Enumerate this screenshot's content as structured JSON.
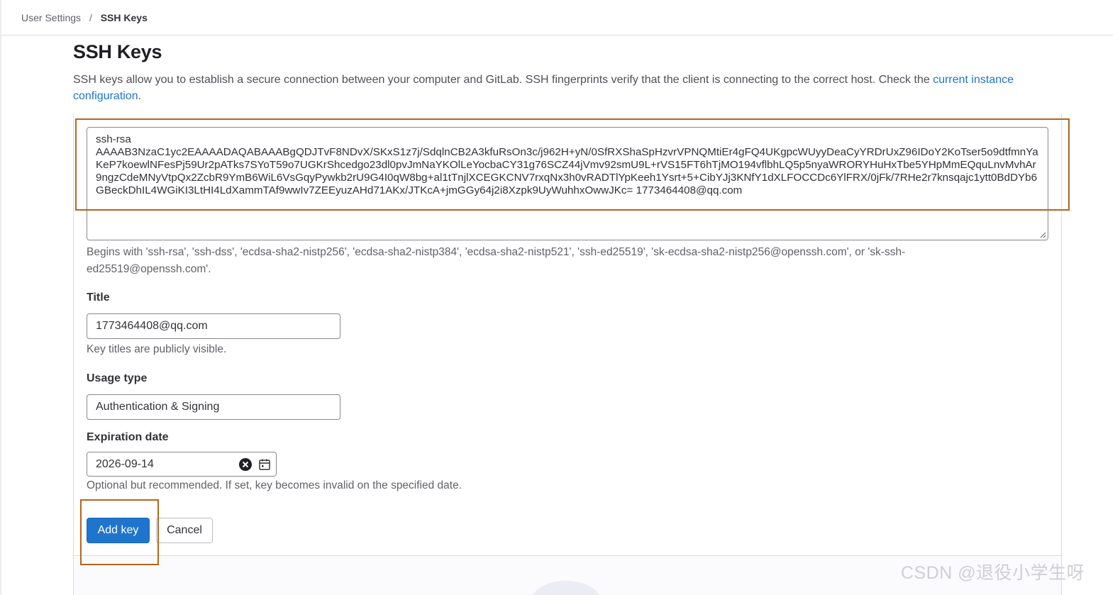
{
  "breadcrumb": {
    "parent": "User Settings",
    "separator": "/",
    "current": "SSH Keys"
  },
  "page": {
    "title": "SSH Keys",
    "description_prefix": "SSH keys allow you to establish a secure connection between your computer and GitLab. SSH fingerprints verify that the client is connecting to the correct host. Check the ",
    "description_link": "current instance configuration",
    "description_suffix": "."
  },
  "key_field": {
    "value": "ssh-rsa\nAAAAB3NzaC1yc2EAAAADAQABAAABgQDJTvF8NDvX/SKxS1z7j/SdqlnCB2A3kfuRsOn3c/j962H+yN/0SfRXShaSpHzvrVPNQMtiEr4gFQ4UKgpcWUyyDeaCyYRDrUxZ96IDoY2KoTser5o9dtfmnYaKeP7koewlNFesPj59Ur2pATks7SYoT59o7UGKrShcedgo23dl0pvJmNaYKOlLeYocbaCY31g76SCZ44jVmv92smU9L+rVS15FT6hTjMO194vflbhLQ5p5nyaWRORYHuHxTbe5YHpMmEQquLnvMvhAr9ngzCdeMNyVtpQx2ZcbR9YmB6WiL6VsGqyPywkb2rU9G4I0qW8bg+al1tTnjlXCEGKCNV7rxqNx3h0vRADTlYpKeeh1Ysrt+5+CibYJj3KNfY1dXLFOCCDc6YlFRX/0jFk/7RHe2r7knsqajc1ytt0BdDYb6GBeckDhIL4WGiKI3LtHI4LdXammTAf9wwIv7ZEEyuzAHd71AKx/JTKcA+jmGGy64j2i8Xzpk9UyWuhhxOwwJKc= 1773464408@qq.com",
    "help": "Begins with 'ssh-rsa', 'ssh-dss', 'ecdsa-sha2-nistp256', 'ecdsa-sha2-nistp384', 'ecdsa-sha2-nistp521', 'ssh-ed25519', 'sk-ecdsa-sha2-nistp256@openssh.com', or 'sk-ssh-ed25519@openssh.com'."
  },
  "title_field": {
    "label": "Title",
    "value": "1773464408@qq.com",
    "help": "Key titles are publicly visible."
  },
  "usage_field": {
    "label": "Usage type",
    "value": "Authentication & Signing"
  },
  "expiration_field": {
    "label": "Expiration date",
    "value": "2026-09-14",
    "help": "Optional but recommended. If set, key becomes invalid on the specified date.",
    "clear_icon": "clear-circle-icon",
    "calendar_icon": "calendar-icon"
  },
  "actions": {
    "add_label": "Add key",
    "cancel_label": "Cancel"
  },
  "watermark": "CSDN @退役小学生呀",
  "colors": {
    "primary": "#1f75cb",
    "link": "#1f75cb",
    "annotation": "#b5651d"
  }
}
